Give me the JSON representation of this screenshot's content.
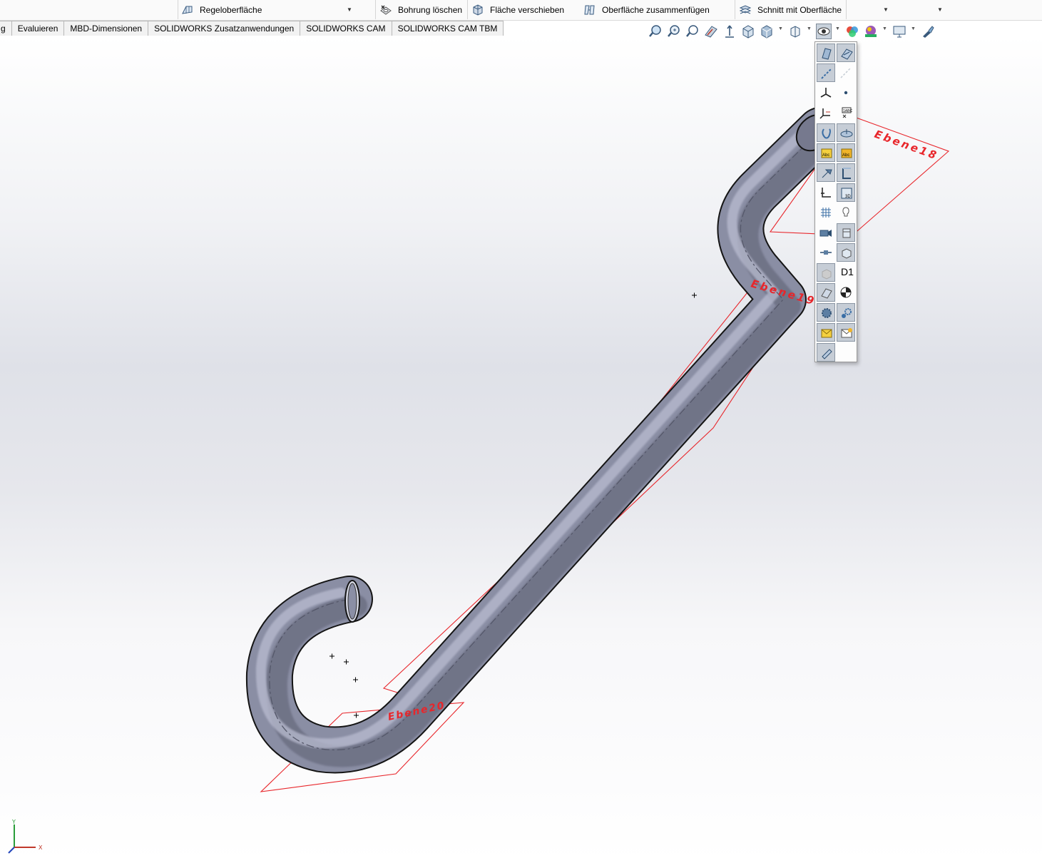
{
  "command_bar": {
    "items": [
      {
        "label": "Regeloberfläche",
        "icon": "ruled-surface-icon"
      },
      {
        "label": "Bohrung löschen",
        "icon": "delete-hole-icon"
      },
      {
        "label": "Fläche verschieben",
        "icon": "move-face-icon"
      },
      {
        "label": "Oberfläche zusammenfügen",
        "icon": "knit-surface-icon"
      },
      {
        "label": "Schnitt mit Oberfläche",
        "icon": "cut-with-surface-icon"
      }
    ]
  },
  "tabs": [
    "g",
    "Evaluieren",
    "MBD-Dimensionen",
    "SOLIDWORKS Zusatzanwendungen",
    "SOLIDWORKS CAM",
    "SOLIDWORKS CAM TBM"
  ],
  "view_toolbar": {
    "icons": [
      "zoom-to-fit-icon",
      "zoom-to-area-icon",
      "previous-view-icon",
      "section-view-icon",
      "dynamic-annotation-icon",
      "view-orientation-icon",
      "display-style-icon",
      "hide-show-items-icon",
      "edit-appearance-icon",
      "apply-scene-icon",
      "view-settings-icon",
      "realview-icon"
    ]
  },
  "flyout": {
    "label_d1": "D1",
    "buttons": [
      "view-planes-icon",
      "view-sketches-planes-icon",
      "view-axes-icon",
      "view-temporary-axes-icon",
      "view-origins-icon",
      "view-points-icon",
      "view-coordinate-systems-icon",
      "view-annotation-icon",
      "view-curves-icon",
      "view-parting-lines-icon",
      "view-sketch-dimensions-icon",
      "view-all-annotations-icon",
      "view-sketch-relations-icon",
      "view-routing-points-icon",
      "view-weld-beads-icon",
      "view-3d-sketch-planes-icon",
      "view-grid-icon",
      "view-lights-icon",
      "view-cameras-icon",
      "view-decals-icon",
      "view-center-of-mass-icon",
      "view-mates-icon",
      "view-bodies-icon",
      "view-dimension-names-icon",
      "view-sketch-planes-icon",
      "view-origin-marker-icon",
      "view-live-sections-icon",
      "view-reference-gears-icon",
      "view-envelopes-icon",
      "view-dimxpert-icon",
      "view-weld-symbols-icon"
    ]
  },
  "scene": {
    "planes": [
      "Ebene18",
      "Ebene19",
      "Ebene20"
    ],
    "plane_color": "#e8262b",
    "tube_color": "#8a8ea4"
  },
  "triad": {
    "x_label": "X",
    "y_label": "Y"
  }
}
